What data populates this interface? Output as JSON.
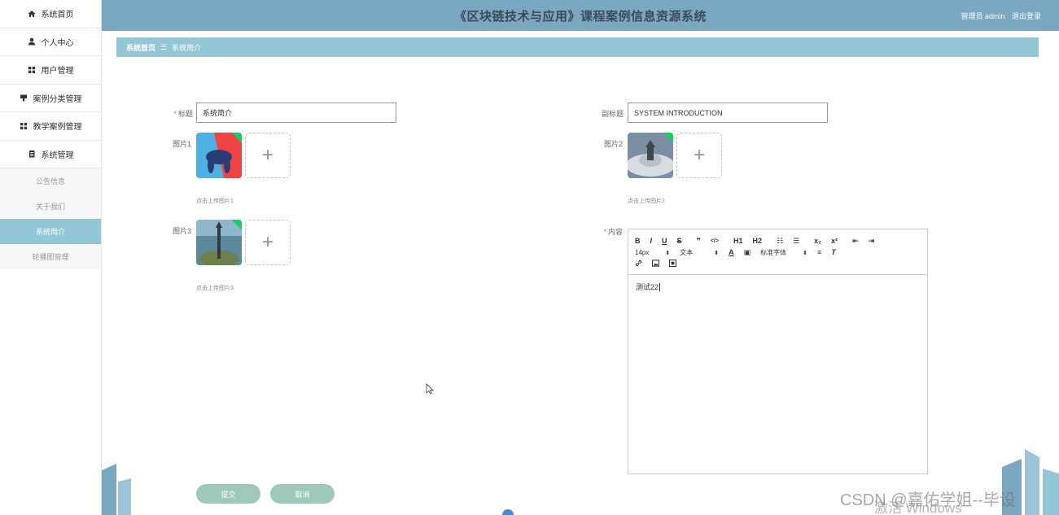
{
  "sidebar": {
    "items": [
      {
        "label": "系统首页",
        "icon": "home-icon"
      },
      {
        "label": "个人中心",
        "icon": "user-icon"
      },
      {
        "label": "用户管理",
        "icon": "grid-icon"
      },
      {
        "label": "案例分类管理",
        "icon": "flag-icon"
      },
      {
        "label": "教学案例管理",
        "icon": "grid-icon"
      },
      {
        "label": "系统管理",
        "icon": "doc-icon"
      }
    ],
    "subitems": [
      {
        "label": "公告信息",
        "active": false
      },
      {
        "label": "关于我们",
        "active": false
      },
      {
        "label": "系统简介",
        "active": true
      },
      {
        "label": "轮播图管理",
        "active": false
      }
    ]
  },
  "header": {
    "title": "《区块链技术与应用》课程案例信息资源系统",
    "user_role": "管理员 admin",
    "logout": "退出登录"
  },
  "breadcrumb": {
    "home": "系统首页",
    "sep": "☰",
    "current": "系统简介"
  },
  "form": {
    "title_label": "标题",
    "title_value": "系统简介",
    "subtitle_label": "副标题",
    "subtitle_value": "SYSTEM INTRODUCTION",
    "image1_label": "图片1",
    "image1_hint": "点击上传图片1",
    "image2_label": "图片2",
    "image2_hint": "点击上传图片2",
    "image3_label": "图片3",
    "image3_hint": "点击上传图片3",
    "content_label": "内容",
    "content_value": "测试22"
  },
  "editor": {
    "row1": [
      "B",
      "I",
      "U",
      "S",
      "❞",
      "</>",
      "H1",
      "H2",
      "☷",
      "☰",
      "x₂",
      "x²",
      "⇤",
      "⇥"
    ],
    "size_value": "14px",
    "type_value": "文本",
    "font_value": "标准字体"
  },
  "buttons": {
    "submit": "提交",
    "cancel": "取消"
  },
  "watermark": {
    "csdn": "CSDN @嘉佑学姐--毕设",
    "windows": "激活 Windows"
  },
  "colors": {
    "header": "#7aa8c2",
    "breadcrumb": "#94c7d6",
    "button": "#9ec9b8",
    "active": "#94c7d6"
  }
}
